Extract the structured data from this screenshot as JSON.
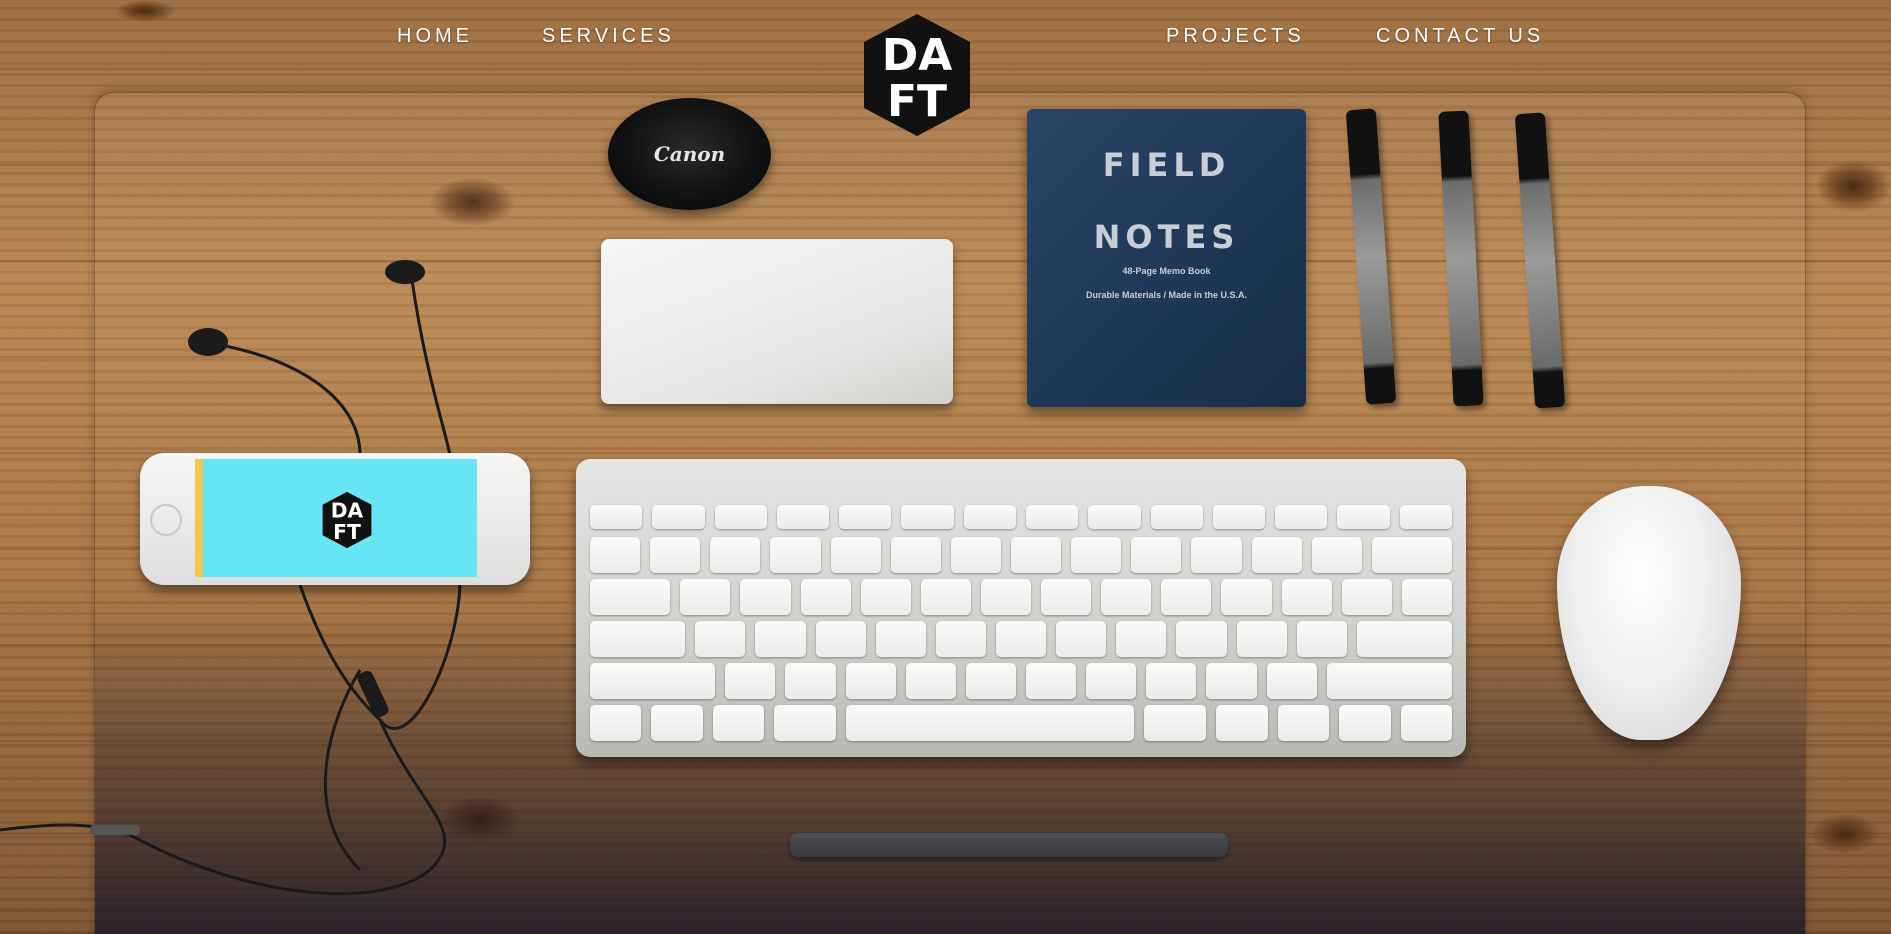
{
  "nav": {
    "home": "HOME",
    "services": "SERVICES",
    "projects": "PROJECTS",
    "contact": "CONTACT US"
  },
  "logo": {
    "line1": "DA",
    "line2": "FT"
  },
  "scene": {
    "lens_cap_brand": "Canon",
    "notebook_title_line1": "FIELD",
    "notebook_title_line2": "NOTES",
    "notebook_subtitle_line1": "48-Page Memo Book",
    "notebook_subtitle_line2": "Durable Materials / Made in the U.S.A."
  },
  "colors": {
    "nav_text": "#ffffff",
    "logo_bg": "#111111",
    "phone_screen": "#66e5f5"
  }
}
